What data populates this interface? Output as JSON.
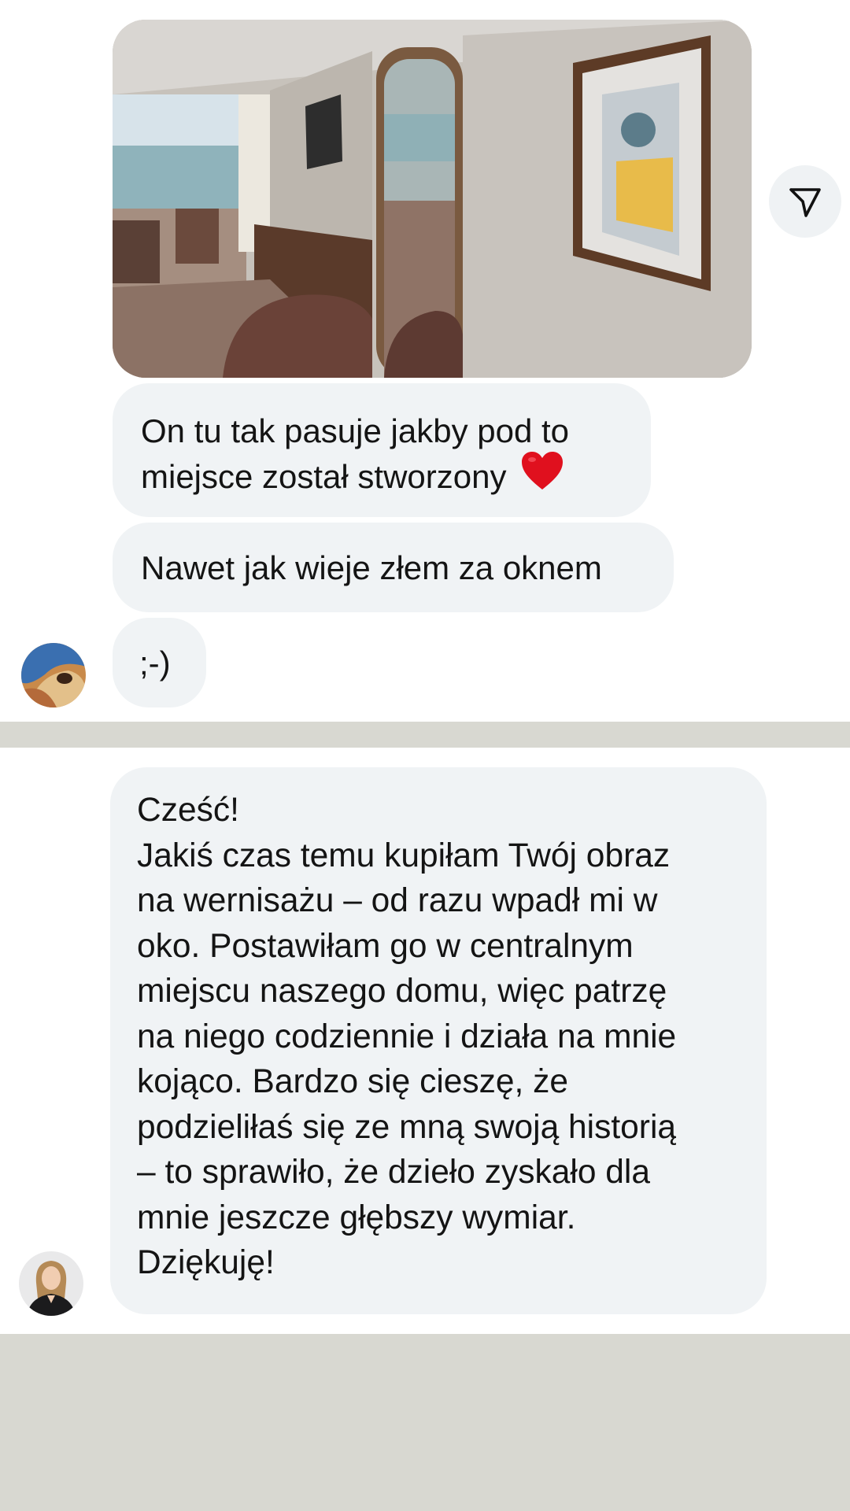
{
  "thread_top": {
    "messages": [
      {
        "text_lines": [
          "On tu tak pasuje jakby pod to",
          "miejsce został stworzony"
        ],
        "emoji": "red-heart"
      },
      {
        "text": "Nawet jak wieje złem za oknem"
      },
      {
        "text": ";-)"
      }
    ],
    "share_icon": "paper-plane-icon"
  },
  "thread_bottom": {
    "message_lines": [
      "Cześć!",
      "Jakiś czas temu kupiłam Twój obraz",
      "na wernisażu – od razu wpadł mi w",
      "oko. Postawiłam go w centralnym",
      "miejscu naszego domu, więc patrzę",
      "na niego codziennie i działa na mnie",
      "kojąco. Bardzo się cieszę, że",
      "podzieliłaś się ze mną swoją historią",
      "– to sprawiło, że dzieło zyskało dla",
      "mnie jeszcze głębszy wymiar.",
      "Dziękuję!"
    ]
  },
  "colors": {
    "bubble": "#f0f3f5",
    "background": "#d8d8d1",
    "heart": "#e0101e"
  }
}
